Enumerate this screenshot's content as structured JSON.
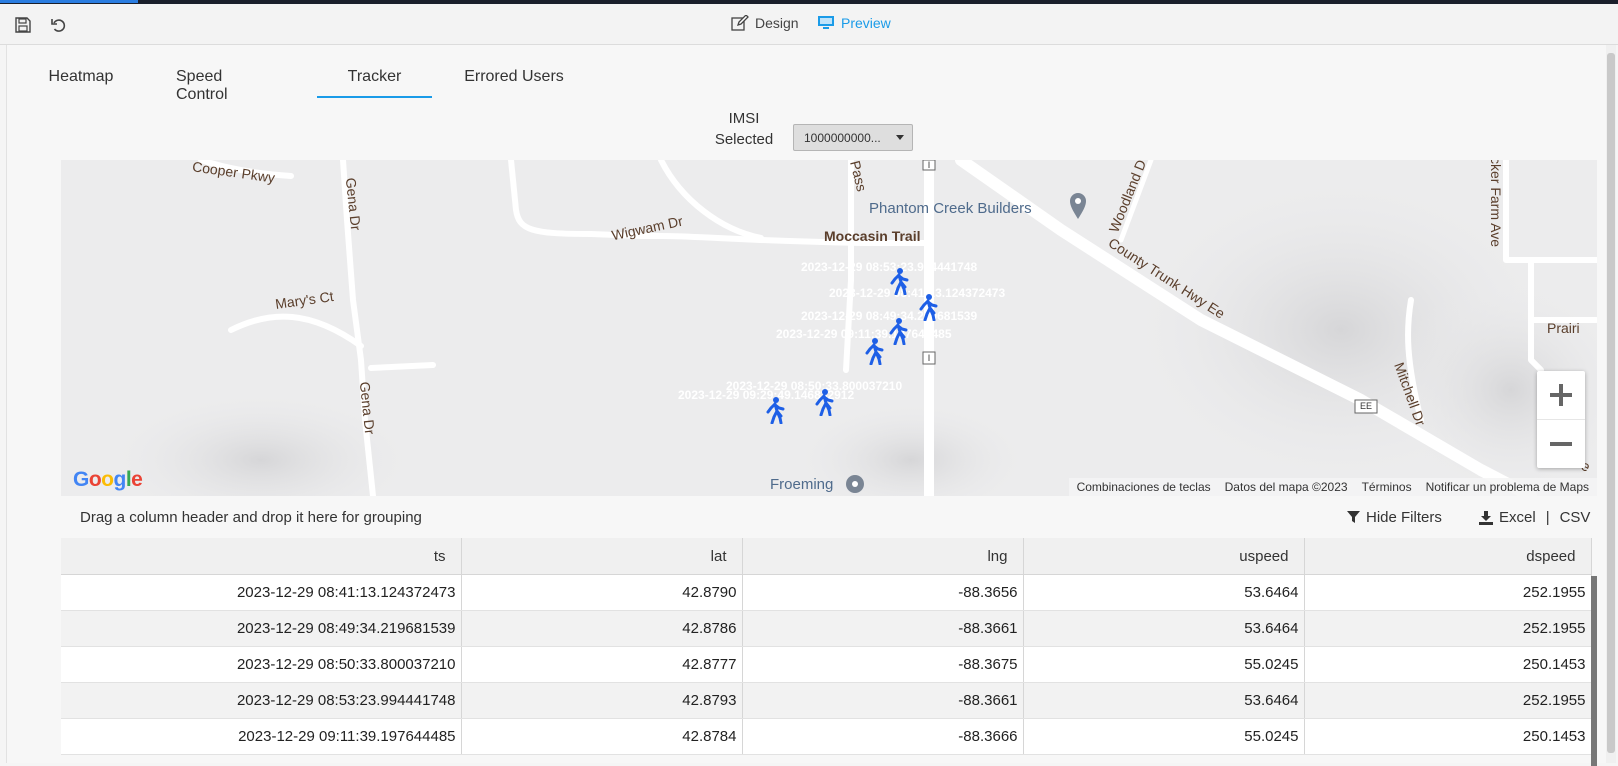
{
  "toolbar": {
    "save_icon": "save-icon",
    "undo_icon": "undo-icon",
    "design_label": "Design",
    "preview_label": "Preview"
  },
  "tabs": [
    {
      "label": "Heatmap",
      "active": false
    },
    {
      "label": "Speed Control",
      "active": false
    },
    {
      "label": "Tracker",
      "active": true
    },
    {
      "label": "Errored Users",
      "active": false
    }
  ],
  "imsi": {
    "label_line1": "IMSI",
    "label_line2": "Selected",
    "selected_value": "1000000000..."
  },
  "map": {
    "streets": [
      "Cooper Pkwy",
      "Gena Dr",
      "Wigwam Dr",
      "Moccasin Trail",
      "Mary's Ct",
      "Gena Dr",
      "Pass",
      "Woodland D",
      "County Trunk Hwy Ee",
      "cker Farm Ave",
      "Prairi",
      "Mitchell Dr",
      "Ave"
    ],
    "places": [
      "Phantom Creek Builders",
      "Froeming"
    ],
    "route_badges": [
      "I",
      "I",
      "EE"
    ],
    "markers": [
      {
        "label": "2023-12-29 08:53:23.994441748"
      },
      {
        "label": "2023-12-29 08:41:13.124372473"
      },
      {
        "label": "2023-12-29 08:49:34.219681539"
      },
      {
        "label": "2023-12-29 09:11:39.197644485"
      },
      {
        "label": "2023-12-29 08:50:33.800037210"
      },
      {
        "label": "2023-12-29 09:29:49.146832912"
      }
    ],
    "zoom_in": "+",
    "zoom_out": "−",
    "logo": "Google",
    "attribution": [
      "Combinaciones de teclas",
      "Datos del mapa ©2023",
      "Términos",
      "Notificar un problema de Maps"
    ]
  },
  "grid": {
    "grouping_hint": "Drag a column header and drop it here for grouping",
    "hide_filters": "Hide Filters",
    "excel": "Excel",
    "separator": "|",
    "csv": "CSV",
    "columns": [
      "ts",
      "lat",
      "lng",
      "uspeed",
      "dspeed"
    ],
    "rows": [
      [
        "2023-12-29 08:41:13.124372473",
        "42.8790",
        "-88.3656",
        "53.6464",
        "252.1955"
      ],
      [
        "2023-12-29 08:49:34.219681539",
        "42.8786",
        "-88.3661",
        "53.6464",
        "252.1955"
      ],
      [
        "2023-12-29 08:50:33.800037210",
        "42.8777",
        "-88.3675",
        "55.0245",
        "250.1453"
      ],
      [
        "2023-12-29 08:53:23.994441748",
        "42.8793",
        "-88.3661",
        "53.6464",
        "252.1955"
      ],
      [
        "2023-12-29 09:11:39.197644485",
        "42.8784",
        "-88.3666",
        "55.0245",
        "250.1453"
      ]
    ]
  },
  "colors": {
    "accent": "#1a9be8",
    "marker": "#1e5fe6"
  }
}
